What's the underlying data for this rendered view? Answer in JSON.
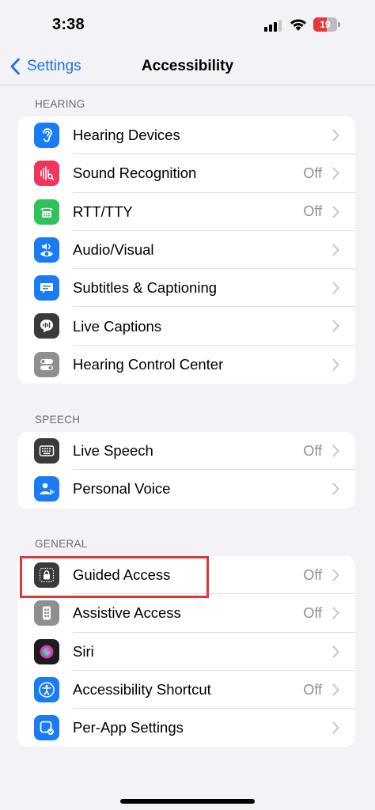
{
  "status": {
    "time": "3:38",
    "battery": "19"
  },
  "nav": {
    "back_label": "Settings",
    "title": "Accessibility"
  },
  "sections": [
    {
      "header": "HEARING",
      "items": [
        {
          "label": "Hearing Devices",
          "value": "",
          "icon": "ear-icon",
          "color": "#1a7cf5"
        },
        {
          "label": "Sound Recognition",
          "value": "Off",
          "icon": "sound-recognition-icon",
          "color": "#f0345c"
        },
        {
          "label": "RTT/TTY",
          "value": "Off",
          "icon": "tty-icon",
          "color": "#2fc25b"
        },
        {
          "label": "Audio/Visual",
          "value": "",
          "icon": "audio-visual-icon",
          "color": "#1a7cf5"
        },
        {
          "label": "Subtitles & Captioning",
          "value": "",
          "icon": "captions-icon",
          "color": "#1a7cf5"
        },
        {
          "label": "Live Captions",
          "value": "",
          "icon": "live-captions-icon",
          "color": "#3a3a3c"
        },
        {
          "label": "Hearing Control Center",
          "value": "",
          "icon": "toggles-icon",
          "color": "#8e8e93"
        }
      ]
    },
    {
      "header": "SPEECH",
      "items": [
        {
          "label": "Live Speech",
          "value": "Off",
          "icon": "keyboard-icon",
          "color": "#3a3a3c"
        },
        {
          "label": "Personal Voice",
          "value": "",
          "icon": "personal-voice-icon",
          "color": "#1a7cf5"
        }
      ]
    },
    {
      "header": "GENERAL",
      "items": [
        {
          "label": "Guided Access",
          "value": "Off",
          "icon": "lock-icon",
          "color": "#3a3a3c"
        },
        {
          "label": "Assistive Access",
          "value": "Off",
          "icon": "assistive-access-icon",
          "color": "#8e8e93"
        },
        {
          "label": "Siri",
          "value": "",
          "icon": "siri-icon",
          "color": "#1c1c1e"
        },
        {
          "label": "Accessibility Shortcut",
          "value": "Off",
          "icon": "accessibility-icon",
          "color": "#1a7cf5"
        },
        {
          "label": "Per-App Settings",
          "value": "",
          "icon": "per-app-icon",
          "color": "#1a7cf5"
        }
      ]
    }
  ]
}
